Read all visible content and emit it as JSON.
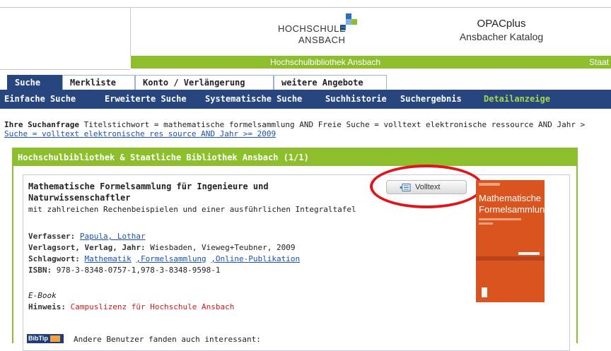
{
  "header": {
    "logo_line1": "HOCHSCHULE",
    "logo_line2": "ANSBACH",
    "app_title": "OPACplus",
    "app_subtitle": "Ansbacher Katalog",
    "bar_library": "Hochschulbibliothek Ansbach",
    "bar_staat": "Staat",
    "colors": {
      "green": "#8dbe2c",
      "navy": "#27467f"
    }
  },
  "tabs": [
    {
      "label": "Suche",
      "active": true
    },
    {
      "label": "Merkliste",
      "active": false
    },
    {
      "label": "Konto / Verlängerung",
      "active": false
    },
    {
      "label": "weitere Angebote",
      "active": false
    }
  ],
  "subnav": [
    {
      "label": "Einfache Suche",
      "current": false
    },
    {
      "label": "Erweiterte Suche",
      "current": false
    },
    {
      "label": "Systematische Suche",
      "current": false
    },
    {
      "label": "Suchhistorie",
      "current": false
    },
    {
      "label": "Suchergebnis",
      "current": false
    },
    {
      "label": "Detailanzeige",
      "current": true
    }
  ],
  "query": {
    "label": "Ihre Suchanfrage",
    "text": "Titelstichwort = mathematische formelsammlung AND Freie Suche = volltext elektronische ressource AND Jahr >",
    "link": "Suche = volltext elektronische res source AND Jahr >= 2009"
  },
  "results": {
    "header": "Hochschulbibliothek & Staatliche Bibliothek Ansbach (1/1)",
    "record": {
      "title": "Mathematische Formelsammlung für Ingenieure und Naturwissenschaftler",
      "subtitle": "mit zahlreichen Rechenbeispielen und einer ausführlichen Integraltafel",
      "verfasser_label": "Verfasser:",
      "verfasser_value": "Papula, Lothar",
      "verlag_label": "Verlagsort, Verlag, Jahr:",
      "verlag_value": "Wiesbaden, Vieweg+Teubner, 2009",
      "schlagwort_label": "Schlagwort:",
      "schlagwort_1": "Mathematik",
      "schlagwort_2": ",Formelsammlung",
      "schlagwort_3": ",Online-Publikation",
      "isbn_label": "ISBN:",
      "isbn_value": "978-3-8348-0757-1,978-3-8348-9598-1",
      "media_type": "E-Book",
      "hinweis_label": "Hinweis:",
      "hinweis_value": "Campuslizenz für Hochschule Ansbach",
      "volltext_button": "Volltext",
      "cover_line1": "Mathematische",
      "cover_line2": "Formelsammlung"
    }
  },
  "bibtip": {
    "badge": "BibTip",
    "text": "Andere Benutzer fanden auch interessant:"
  }
}
